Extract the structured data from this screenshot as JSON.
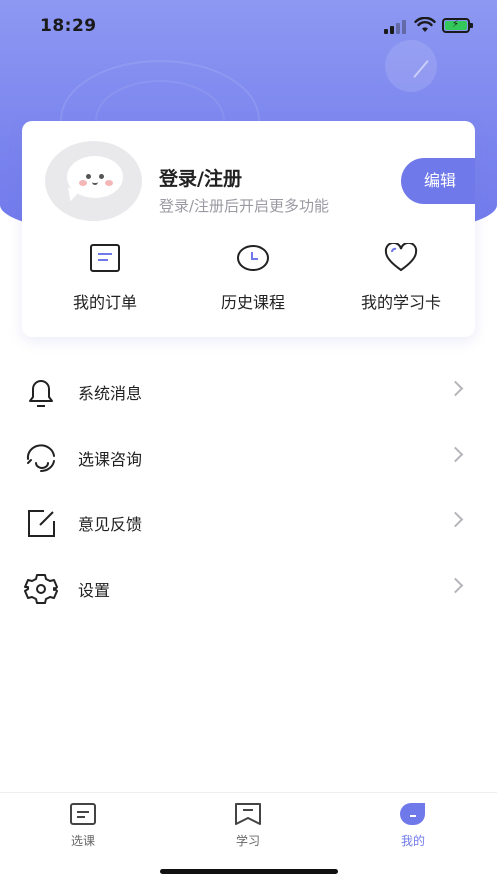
{
  "status_bar": {
    "time": "18:29"
  },
  "profile": {
    "title": "登录/注册",
    "subtitle": "登录/注册后开启更多功能",
    "edit_label": "编辑"
  },
  "quick_links": [
    {
      "label": "我的订单",
      "icon": "order-icon"
    },
    {
      "label": "历史课程",
      "icon": "clock-icon"
    },
    {
      "label": "我的学习卡",
      "icon": "heart-icon"
    }
  ],
  "menu": [
    {
      "label": "系统消息",
      "icon": "bell-icon"
    },
    {
      "label": "选课咨询",
      "icon": "headset-icon"
    },
    {
      "label": "意见反馈",
      "icon": "feedback-icon"
    },
    {
      "label": "设置",
      "icon": "gear-icon"
    }
  ],
  "tabbar": {
    "tabs": [
      {
        "label": "选课",
        "icon": "course-list-icon",
        "active": false
      },
      {
        "label": "学习",
        "icon": "study-icon",
        "active": false
      },
      {
        "label": "我的",
        "icon": "profile-icon",
        "active": true
      }
    ]
  },
  "colors": {
    "accent": "#7079ea",
    "header_gradient_top": "#8d98f2",
    "header_gradient_bottom": "#6f78eb",
    "battery": "#34c759"
  }
}
